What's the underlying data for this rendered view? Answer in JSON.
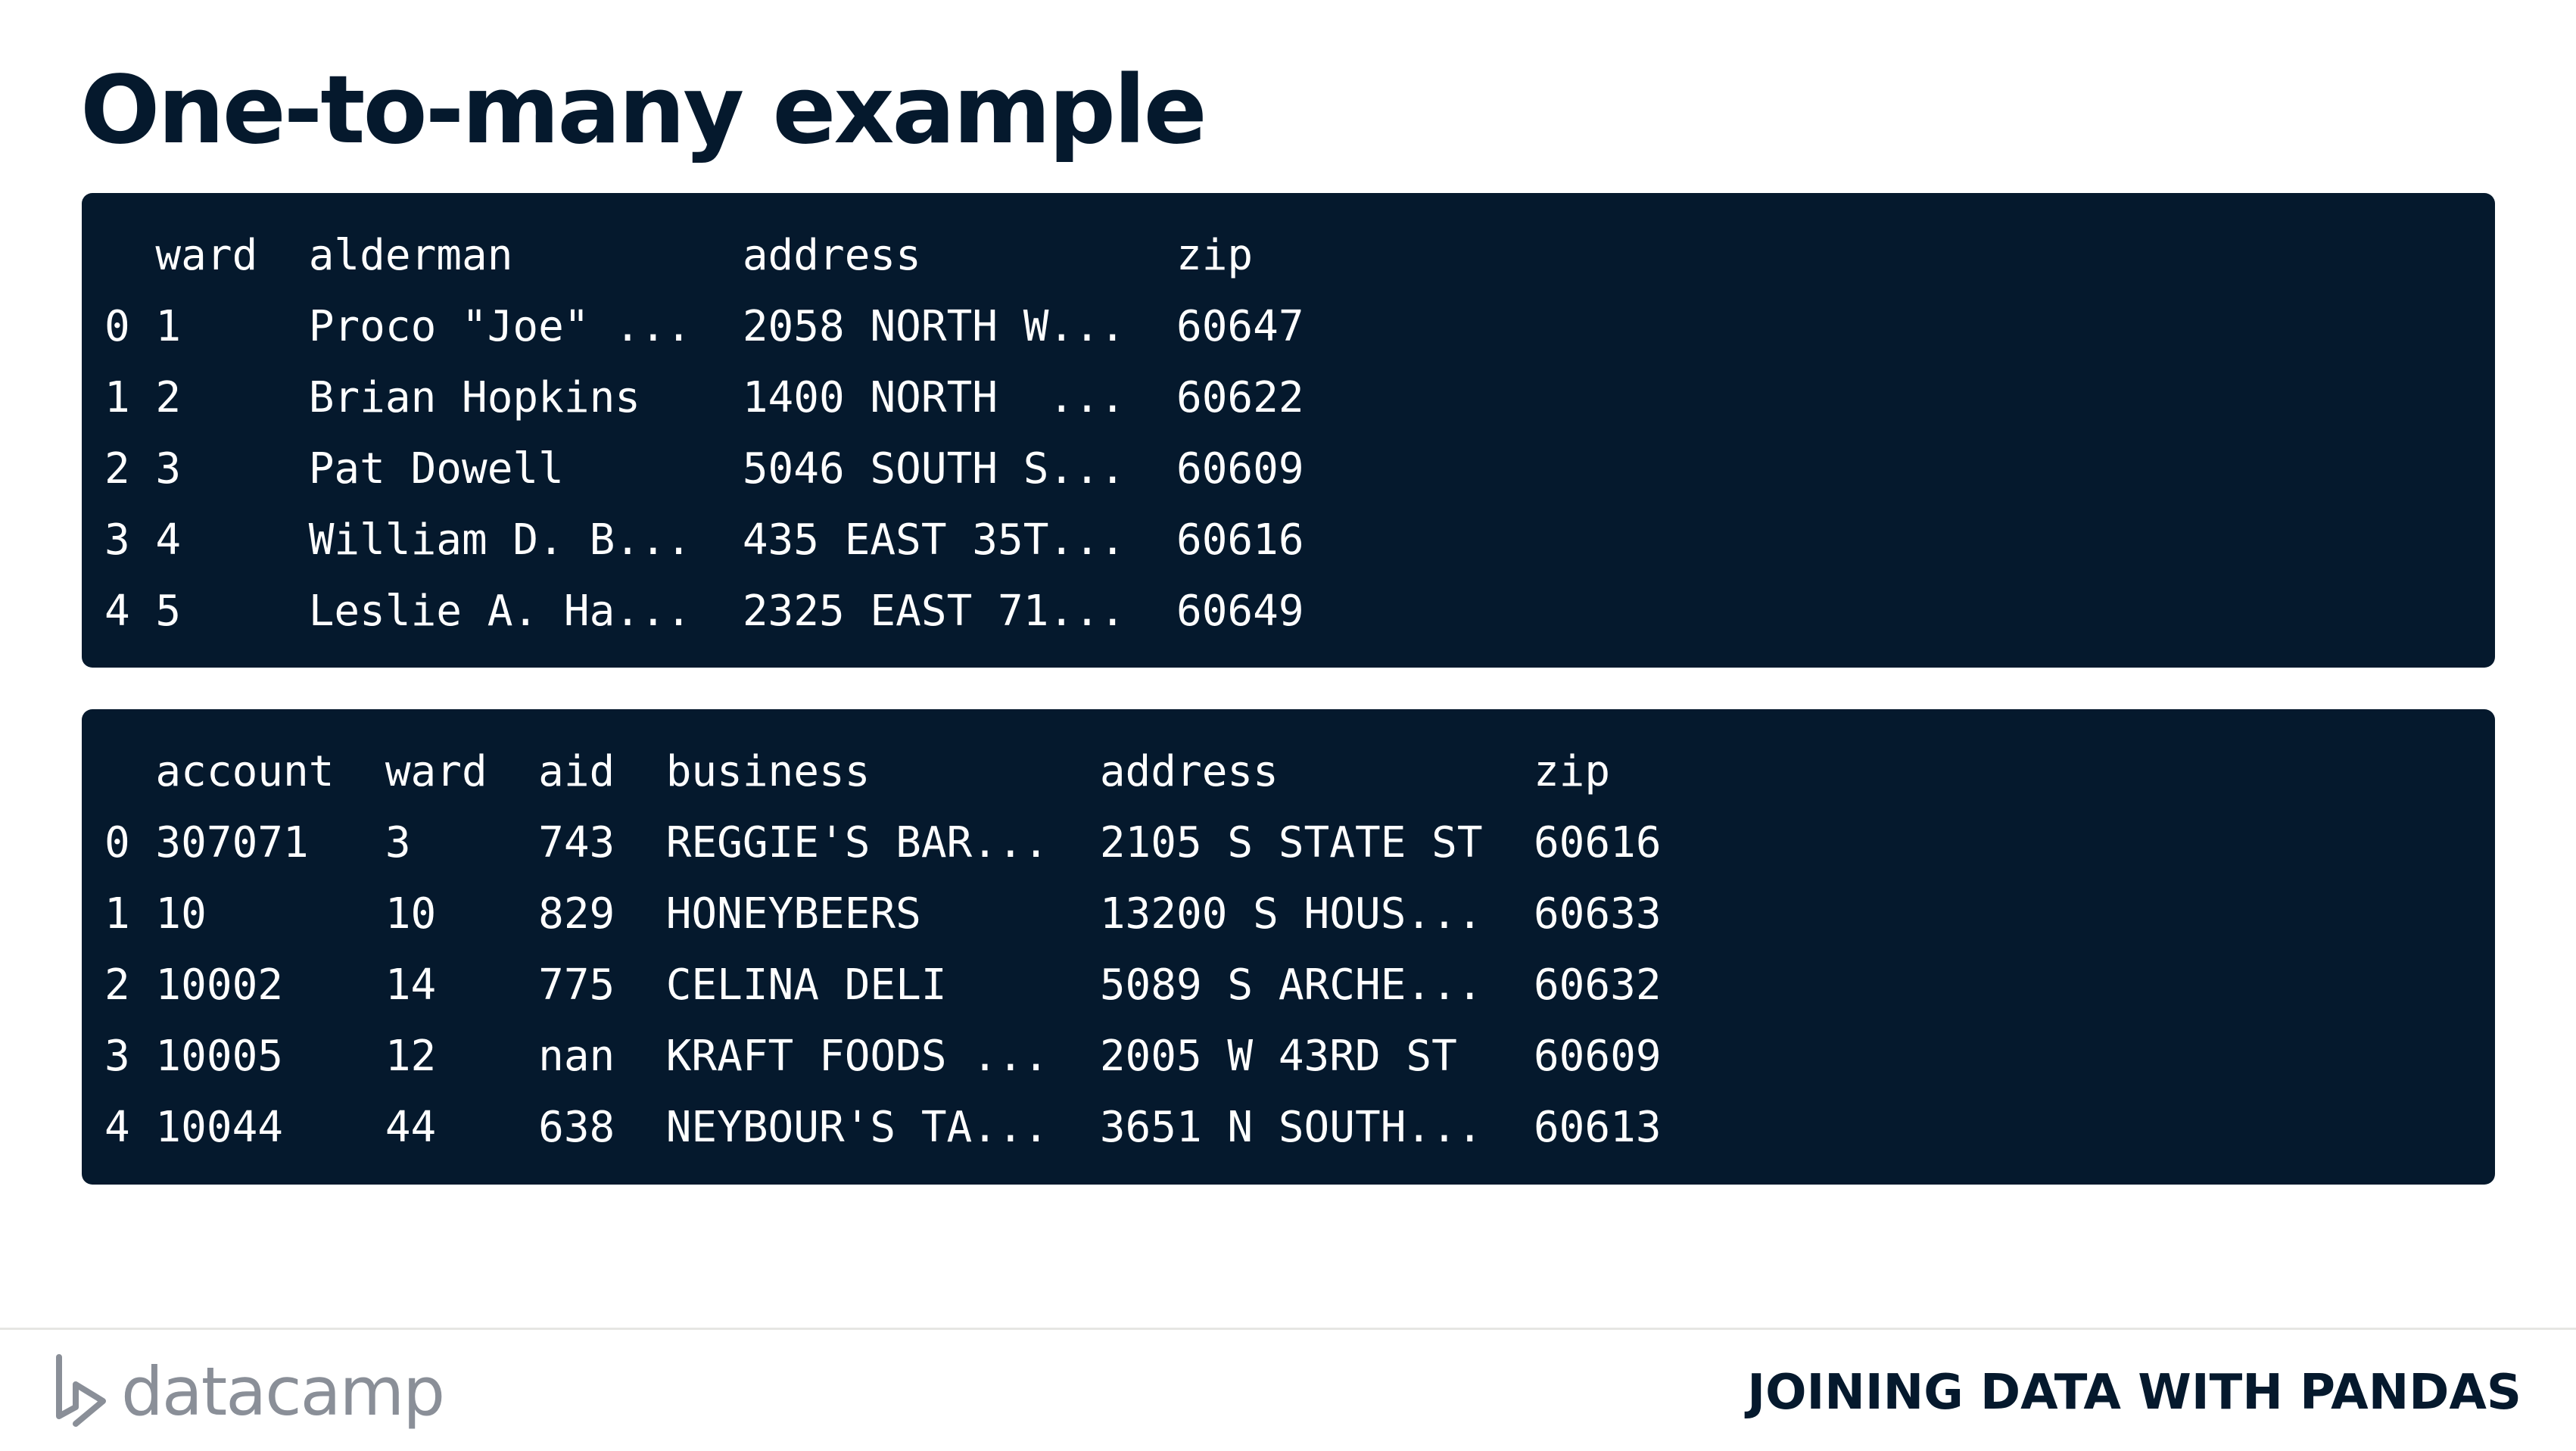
{
  "title": "One-to-many example",
  "wards_table": {
    "columns": [
      "",
      "ward",
      "alderman",
      "address",
      "zip"
    ],
    "rows": [
      [
        "0",
        "1",
        "Proco \"Joe\" ...",
        "2058 NORTH W...",
        "60647"
      ],
      [
        "1",
        "2",
        "Brian Hopkins",
        "1400 NORTH  ...",
        "60622"
      ],
      [
        "2",
        "3",
        "Pat Dowell",
        "5046 SOUTH S...",
        "60609"
      ],
      [
        "3",
        "4",
        "William D. B...",
        "435 EAST 35T...",
        "60616"
      ],
      [
        "4",
        "5",
        "Leslie A. Ha...",
        "2325 EAST 71...",
        "60649"
      ]
    ]
  },
  "licenses_table": {
    "columns": [
      "",
      "account",
      "ward",
      "aid",
      "business",
      "address",
      "zip"
    ],
    "rows": [
      [
        "0",
        "307071",
        "3",
        "743",
        "REGGIE'S BAR...",
        "2105 S STATE ST",
        "60616"
      ],
      [
        "1",
        "10",
        "10",
        "829",
        "HONEYBEERS",
        "13200 S HOUS...",
        "60633"
      ],
      [
        "2",
        "10002",
        "14",
        "775",
        "CELINA DELI",
        "5089 S ARCHE...",
        "60632"
      ],
      [
        "3",
        "10005",
        "12",
        "nan",
        "KRAFT FOODS ...",
        "2005 W 43RD ST",
        "60609"
      ],
      [
        "4",
        "10044",
        "44",
        "638",
        "NEYBOUR'S TA...",
        "3651 N SOUTH...",
        "60613"
      ]
    ]
  },
  "footer": {
    "logo_text": "datacamp",
    "course_name": "JOINING DATA WITH PANDAS"
  },
  "colors": {
    "navy": "#05192d",
    "logo_gray": "#8a8f98",
    "background": "#ffffff"
  }
}
